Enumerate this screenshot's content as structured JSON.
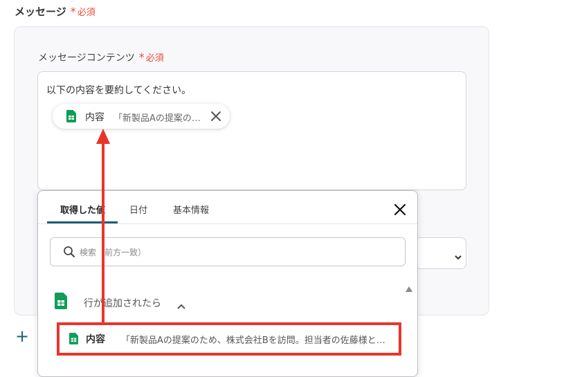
{
  "message_field": {
    "label": "メッセージ",
    "required": "必須"
  },
  "content_field": {
    "label": "メッセージコンテンツ",
    "required": "必須",
    "text": "以下の内容を要約してください。",
    "chip": {
      "title": "内容",
      "value": "「新製品Aの提案の…"
    }
  },
  "popup": {
    "tabs": [
      {
        "label": "取得した値",
        "active": true
      },
      {
        "label": "日付",
        "active": false
      },
      {
        "label": "基本情報",
        "active": false
      }
    ],
    "search": {
      "placeholder": "検索（前方一致）"
    },
    "group": {
      "title": "行が追加されたら",
      "expanded": true
    },
    "option": {
      "title": "内容",
      "value": "「新製品Aの提案のため、株式会社Bを訪問。担当者の佐藤様と…"
    }
  },
  "icons": {
    "sheet": "google-sheets-icon",
    "close": "close-icon",
    "search": "search-icon",
    "add": "plus-icon"
  },
  "colors": {
    "required": "#e74c3c",
    "accent": "#1d5f74",
    "highlight": "#e8352b",
    "sheets_green": "#0f9d58"
  }
}
